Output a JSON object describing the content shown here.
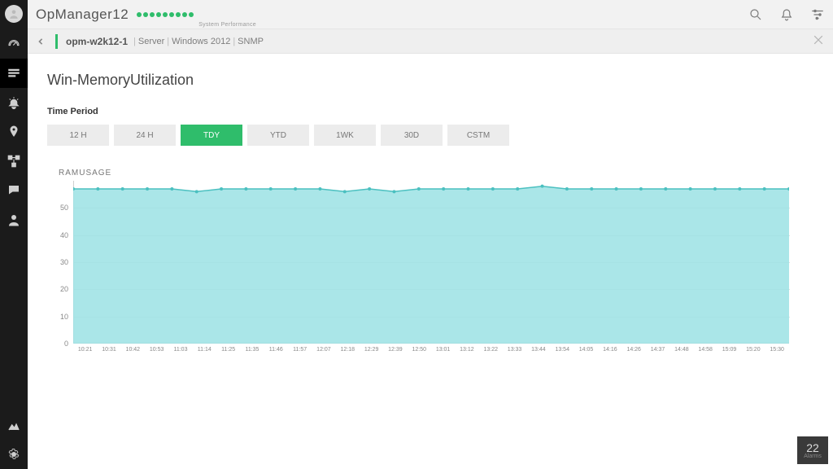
{
  "topbar": {
    "title": "OpManager12",
    "subtitle": "System Performance",
    "dot_count": 9
  },
  "breadcrumb": {
    "host": "opm-w2k12-1",
    "parts": [
      "Server",
      "Windows 2012",
      "SNMP"
    ]
  },
  "page": {
    "title": "Win-MemoryUtilization",
    "time_period_label": "Time Period",
    "period_buttons": [
      "12 H",
      "24 H",
      "TDY",
      "YTD",
      "1WK",
      "30D",
      "CSTM"
    ],
    "active_period_index": 2
  },
  "chart_data": {
    "type": "area",
    "title": "RAMUSAGE",
    "ylabel": "",
    "xlabel": "",
    "ylim": [
      0,
      60
    ],
    "yticks": [
      0,
      10,
      20,
      30,
      40,
      50
    ],
    "categories": [
      "10:21",
      "10:31",
      "10:42",
      "10:53",
      "11:03",
      "11:14",
      "11:25",
      "11:35",
      "11:46",
      "11:57",
      "12:07",
      "12:18",
      "12:29",
      "12:39",
      "12:50",
      "13:01",
      "13:12",
      "13:22",
      "13:33",
      "13:44",
      "13:54",
      "14:05",
      "14:16",
      "14:26",
      "14:37",
      "14:48",
      "14:58",
      "15:09",
      "15:20",
      "15:30"
    ],
    "series": [
      {
        "name": "RAMUSAGE",
        "color_line": "#4bc0c0",
        "color_fill": "#9be2e4",
        "values": [
          57,
          57,
          57,
          57,
          57,
          56,
          57,
          57,
          57,
          57,
          57,
          56,
          57,
          56,
          57,
          57,
          57,
          57,
          57,
          58,
          57,
          57,
          57,
          57,
          57,
          57,
          57,
          57,
          57,
          57
        ]
      }
    ]
  },
  "alarms": {
    "count": "22",
    "label": "Alarms"
  },
  "rail_items": [
    "dashboard",
    "inventory",
    "alarms",
    "maps",
    "workflow",
    "chat",
    "user"
  ],
  "rail_bottom": [
    "reports",
    "settings"
  ]
}
